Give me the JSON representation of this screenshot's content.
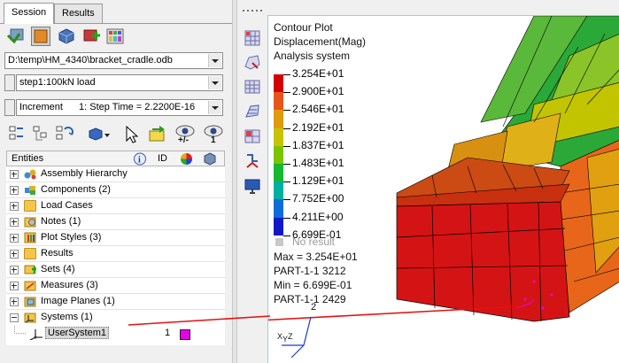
{
  "tabs": {
    "session": "Session",
    "results": "Results"
  },
  "file_path": "D:\\temp\\HM_4340\\bracket_cradle.odb",
  "step_select": "step1:100kN load",
  "increment_select": {
    "type": "Increment",
    "value": "1: Step Time =   2.2200E-16"
  },
  "entity_header": {
    "entities": "Entities",
    "id": "ID"
  },
  "tree": [
    {
      "label": "Assembly Hierarchy",
      "icon": "assembly-icon"
    },
    {
      "label": "Components (2)",
      "icon": "components-icon"
    },
    {
      "label": "Load Cases",
      "icon": "folder-icon"
    },
    {
      "label": "Notes (1)",
      "icon": "notes-icon"
    },
    {
      "label": "Plot Styles (3)",
      "icon": "plot-styles-icon"
    },
    {
      "label": "Results",
      "icon": "folder-icon"
    },
    {
      "label": "Sets  (4)",
      "icon": "sets-icon"
    },
    {
      "label": "Measures (3)",
      "icon": "measures-icon"
    },
    {
      "label": "Image Planes (1)",
      "icon": "image-planes-icon"
    },
    {
      "label": "Systems (1)",
      "icon": "systems-icon"
    }
  ],
  "user_system": {
    "label": "UserSystem1",
    "id": "1",
    "color": "#e800e8"
  },
  "contour": {
    "line1": "Contour Plot",
    "line2": "Displacement(Mag)",
    "line3": "Analysis system",
    "legend": [
      {
        "value": "3.254E+01",
        "color": "#d40000"
      },
      {
        "value": "2.900E+01",
        "color": "#e8551a"
      },
      {
        "value": "2.546E+01",
        "color": "#e09a10"
      },
      {
        "value": "2.192E+01",
        "color": "#c6c400"
      },
      {
        "value": "1.837E+01",
        "color": "#7cc400"
      },
      {
        "value": "1.483E+01",
        "color": "#16b830"
      },
      {
        "value": "1.129E+01",
        "color": "#00b0a0"
      },
      {
        "value": "7.752E+00",
        "color": "#0c6cd8"
      },
      {
        "value": "4.211E+00",
        "color": "#1018c8"
      },
      {
        "value": "6.699E-01",
        "color": "#1018c8"
      }
    ],
    "no_result": "No result",
    "max": "Max = 3.254E+01",
    "max_node": "PART-1-1 3212",
    "min": "Min = 6.699E-01",
    "min_node": "PART-1-1 2429"
  },
  "triad": {
    "x": "X",
    "y": "Y",
    "z": "Z",
    "node_label": "2"
  },
  "eye_labels": {
    "plusminus": "+/-",
    "one": "1"
  },
  "colors": {
    "accent": "#d40000",
    "window_bg": "#f0f0f0",
    "gfx_border": "#9ad0dc"
  }
}
